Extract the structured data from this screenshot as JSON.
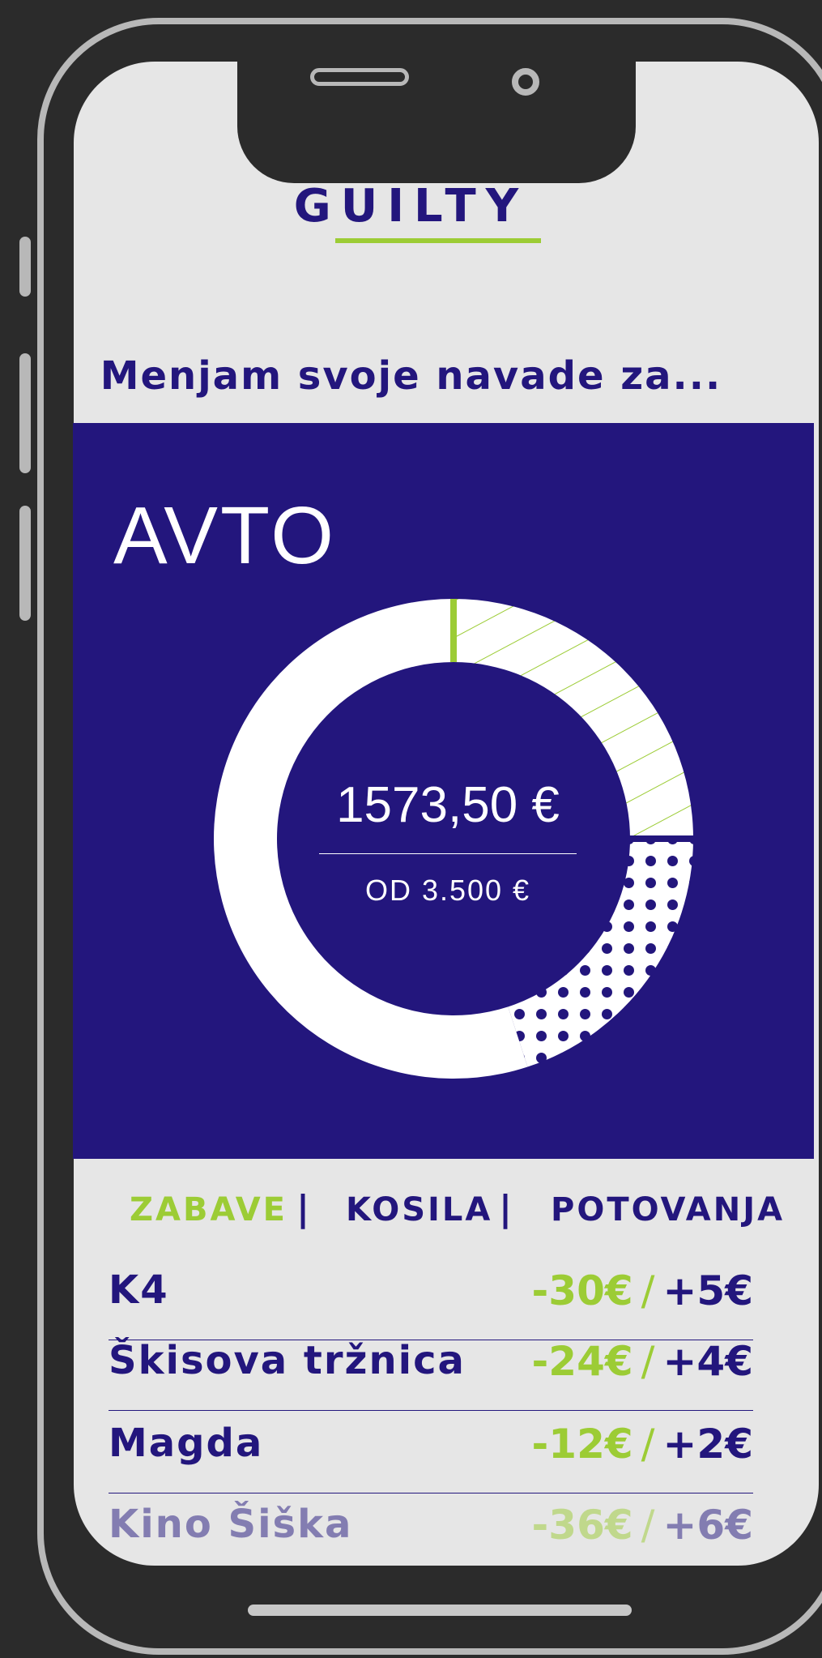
{
  "app": {
    "title": "GUILTY",
    "subtitle": "Menjam svoje navade za..."
  },
  "goal": {
    "category": "AVTO",
    "amount": "1573,50 €",
    "target": "OD 3.500 €",
    "progress_segments": [
      {
        "pattern": "hatched",
        "color": "#9ccc35",
        "fraction": 0.25
      },
      {
        "pattern": "dotted",
        "color": "#23167d",
        "fraction": 0.2
      },
      {
        "pattern": "solid",
        "color": "#ffffff",
        "fraction": 0.55
      }
    ]
  },
  "tabs": [
    {
      "label": "ZABAVE",
      "active": true
    },
    {
      "label": "KOSILA",
      "active": false
    },
    {
      "label": "POTOVANJA",
      "active": false
    }
  ],
  "tab_separator": "|",
  "entries": [
    {
      "name": "K4",
      "saved": "-30€",
      "points": "+5€"
    },
    {
      "name": "Škisova tržnica",
      "saved": "-24€",
      "points": "+4€"
    },
    {
      "name": "Magda",
      "saved": "-12€",
      "points": "+2€"
    },
    {
      "name": "Kino Šiška",
      "saved": "-36€",
      "points": "+6€"
    }
  ],
  "value_separator": "/",
  "colors": {
    "primary": "#23167d",
    "accent": "#9ccc35",
    "screen_bg": "#e6e6e6",
    "device": "#2b2b2b"
  }
}
